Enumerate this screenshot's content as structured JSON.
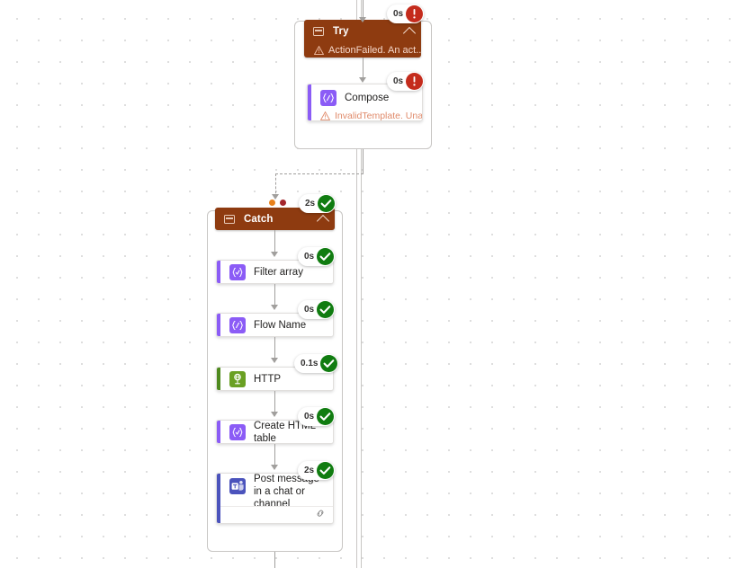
{
  "canvas": {
    "background_color": "#ffffff",
    "dot_grid_color": "#d8d8d8"
  },
  "colors": {
    "scope_header": "#8e3b10",
    "success": "#107c10",
    "error": "#c42b1c",
    "error_text": "#e08a6a",
    "connector": "#a19f9d",
    "data_operation_accent": "#8b5cf6",
    "http_accent": "#4e8a1e",
    "teams_accent": "#4b53bc"
  },
  "scopes": [
    {
      "id": "try-scope",
      "name": "Try",
      "icon": "scope-icon",
      "collapse_icon": "chevron-up-icon",
      "error_text": "ActionFailed. An act...",
      "error_icon": "warning-icon",
      "status": {
        "duration": "0s",
        "state": "failed",
        "icon": "error-icon"
      }
    },
    {
      "id": "catch-scope",
      "name": "Catch",
      "icon": "scope-icon",
      "collapse_icon": "chevron-up-icon",
      "error_text": "",
      "status": {
        "duration": "2s",
        "state": "succeeded",
        "icon": "success-icon"
      }
    }
  ],
  "try_actions": [
    {
      "id": "compose",
      "label": "Compose",
      "icon": "compose-icon",
      "accent": "#8b5cf6",
      "error_text": "InvalidTemplate. Unable to ...",
      "error_icon": "warning-icon",
      "status": {
        "duration": "0s",
        "state": "failed",
        "icon": "error-icon"
      }
    }
  ],
  "catch_actions": [
    {
      "id": "filter-array",
      "label": "Filter array",
      "icon": "filter-array-icon",
      "accent": "#8b5cf6",
      "status": {
        "duration": "0s",
        "state": "succeeded",
        "icon": "success-icon"
      }
    },
    {
      "id": "flow-name",
      "label": "Flow Name",
      "icon": "compose-icon",
      "accent": "#8b5cf6",
      "status": {
        "duration": "0s",
        "state": "succeeded",
        "icon": "success-icon"
      }
    },
    {
      "id": "http",
      "label": "HTTP",
      "icon": "http-icon",
      "accent": "#4e8a1e",
      "status": {
        "duration": "0.1s",
        "state": "succeeded",
        "icon": "success-icon"
      }
    },
    {
      "id": "create-html-table",
      "label": "Create HTML table",
      "icon": "create-html-table-icon",
      "accent": "#8b5cf6",
      "status": {
        "duration": "0s",
        "state": "succeeded",
        "icon": "success-icon"
      }
    },
    {
      "id": "post-message-teams",
      "label": "Post message in a chat or channel",
      "icon": "microsoft-teams-icon",
      "accent": "#4b53bc",
      "footer_icon": "copy-link-icon",
      "status": {
        "duration": "2s",
        "state": "succeeded",
        "icon": "success-icon"
      }
    }
  ],
  "run_after_dots": [
    {
      "id": "run-after-dot-orange",
      "color": "#e8801a"
    },
    {
      "id": "run-after-dot-red",
      "color": "#a4262c"
    }
  ]
}
